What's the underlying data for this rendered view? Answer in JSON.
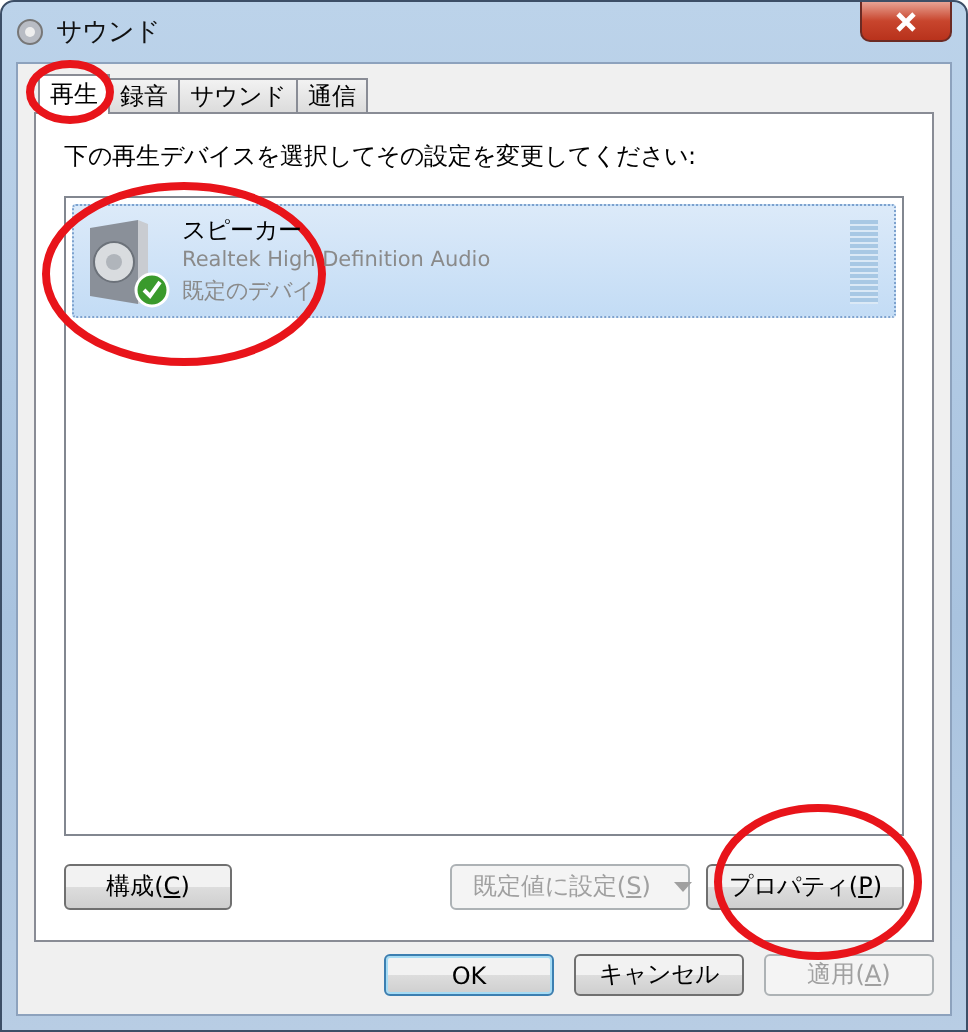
{
  "window": {
    "title": "サウンド"
  },
  "tabs": [
    {
      "label": "再生",
      "selected": true
    },
    {
      "label": "録音",
      "selected": false
    },
    {
      "label": "サウンド",
      "selected": false
    },
    {
      "label": "通信",
      "selected": false
    }
  ],
  "instruction": "下の再生デバイスを選択してその設定を変更してください:",
  "devices": [
    {
      "name": "スピーカー",
      "driver": "Realtek High Definition Audio",
      "status": "既定のデバイ",
      "selected": true,
      "default": true
    }
  ],
  "device_buttons": [
    {
      "kind": "button",
      "label": "構成(",
      "access_key": "C",
      "label_end": ")",
      "disabled": false
    },
    {
      "kind": "split",
      "label": "既定値に設定(",
      "access_key": "S",
      "label_end": ")",
      "disabled": true
    },
    {
      "kind": "button",
      "label": "プロパティ(",
      "access_key": "P",
      "label_end": ")",
      "disabled": false
    }
  ],
  "dialog_buttons": [
    {
      "label": "OK",
      "default": true,
      "disabled": false
    },
    {
      "label": "キャンセル",
      "default": false,
      "disabled": false
    },
    {
      "label": "適用(",
      "access_key": "A",
      "label_end": ")",
      "default": false,
      "disabled": true
    }
  ],
  "annotations": [
    {
      "kind": "ellipse"
    },
    {
      "kind": "ellipse"
    },
    {
      "kind": "ellipse"
    }
  ]
}
